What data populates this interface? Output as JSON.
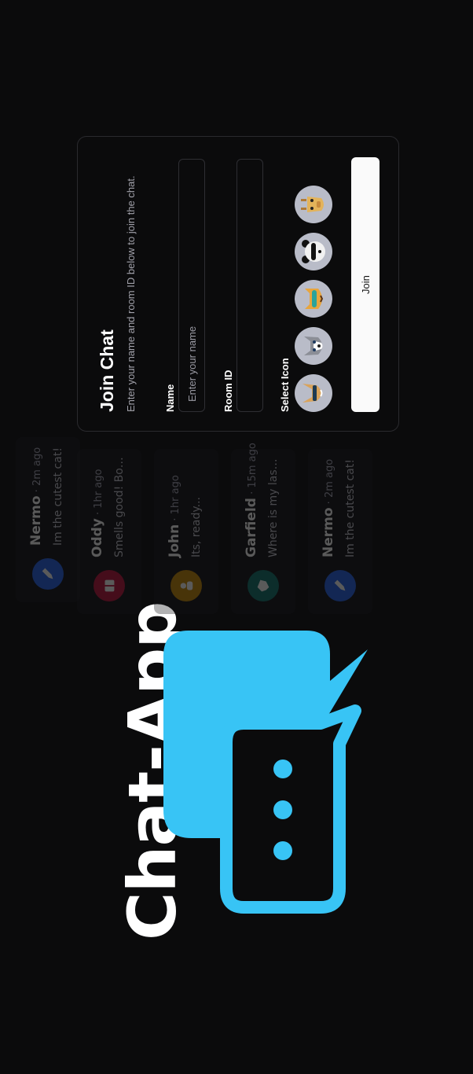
{
  "brand": {
    "title": "Chat-App",
    "accent": "#38c4f5",
    "logo_icon": "chat-bubbles-icon"
  },
  "preview_chats": [
    {
      "name": "Nermo",
      "time": "2m ago",
      "message": "Im the cutest cat!",
      "color": "#2563eb",
      "icon": "pencil-icon"
    },
    {
      "name": "Garfield",
      "time": "15m ago",
      "message": "Where is my lasagna?",
      "color": "#0f766e",
      "icon": "dog-icon"
    },
    {
      "name": "John",
      "time": "1hr ago",
      "message": "Its, ready...",
      "color": "#ca8a04",
      "icon": "person-icon"
    },
    {
      "name": "Oddy",
      "time": "1hr ago",
      "message": "Smells good! Booo...",
      "color": "#be123c",
      "icon": "gift-icon"
    },
    {
      "name": "Nermo",
      "time": "2m ago",
      "message": "Im the cutest cat!",
      "color": "#2563eb",
      "icon": "pencil-icon"
    }
  ],
  "join": {
    "title": "Join Chat",
    "description": "Enter your name and room ID below to join the chat.",
    "name_label": "Name",
    "name_placeholder": "Enter your name",
    "name_value": "",
    "room_label": "Room ID",
    "room_placeholder": "",
    "room_value": "",
    "icon_label": "Select Icon",
    "icons": [
      "fox-sunglasses-icon",
      "husky-icon",
      "cat-sunglasses-icon",
      "panda-sunglasses-icon",
      "giraffe-icon"
    ],
    "button_label": "Join"
  }
}
